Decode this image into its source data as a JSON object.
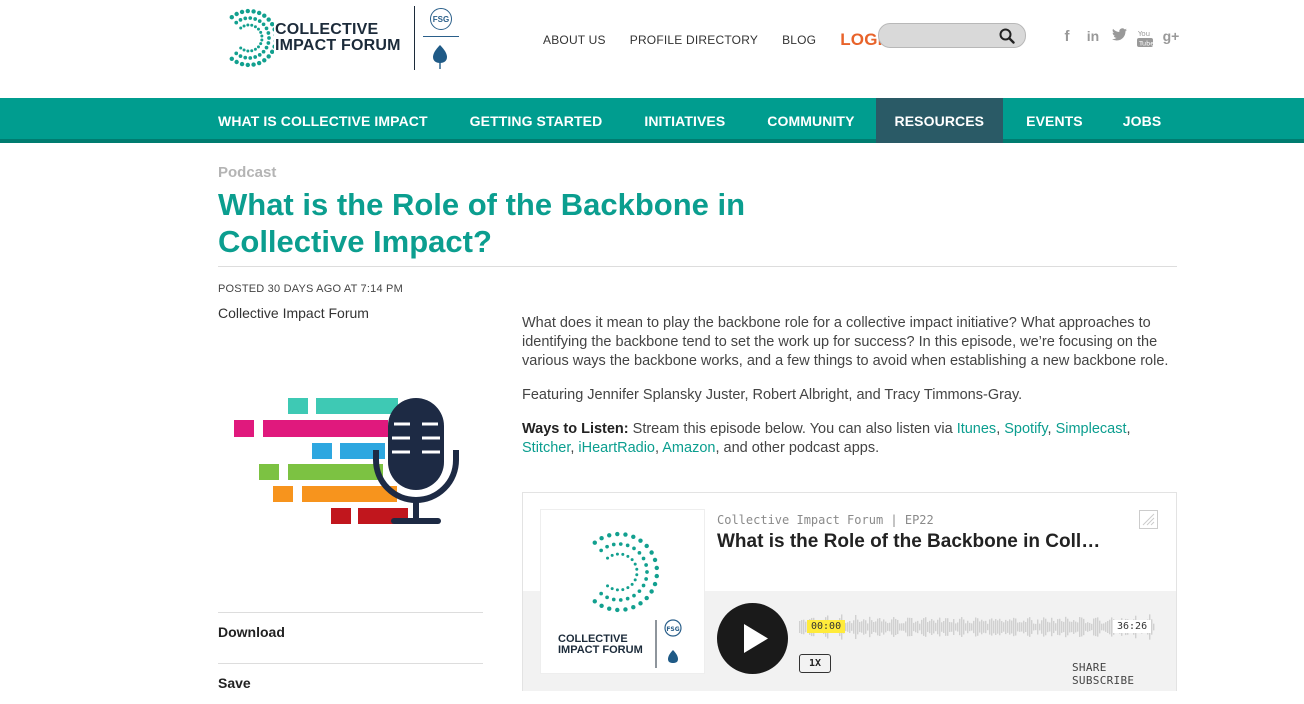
{
  "logo": {
    "line1": "COLLECTIVE",
    "line2": "IMPACT FORUM",
    "badge": "FSG"
  },
  "topnav": {
    "items": [
      "ABOUT US",
      "PROFILE DIRECTORY",
      "BLOG"
    ],
    "login": "LOGIN"
  },
  "search": {
    "placeholder": ""
  },
  "social": [
    "facebook-icon",
    "linkedin-icon",
    "twitter-icon",
    "youtube-icon",
    "google-plus-icon"
  ],
  "mainnav": {
    "items": [
      "WHAT IS COLLECTIVE IMPACT",
      "GETTING STARTED",
      "INITIATIVES",
      "COMMUNITY",
      "RESOURCES",
      "EVENTS",
      "JOBS"
    ],
    "active": "RESOURCES"
  },
  "article": {
    "eyebrow": "Podcast",
    "title": "What is the Role of the Backbone in Collective Impact?",
    "posted": "POSTED 30 DAYS AGO AT 7:14 PM",
    "author": "Collective Impact Forum",
    "p1": "What does it mean to play the backbone role for a collective impact initiative? What approaches to identifying the backbone tend to set the work up for success? In this episode, we’re focusing on the various ways the backbone works, and a few things to avoid when establishing a new backbone role.",
    "p2": "Featuring Jennifer Splansky Juster, Robert Albright, and Tracy Timmons-Gray.",
    "ways_label": "Ways to Listen:",
    "ways_text": " Stream this episode below. You can also listen via ",
    "links": [
      "Itunes",
      "Spotify",
      "Simplecast",
      "Stitcher",
      "iHeartRadio",
      "Amazon"
    ],
    "ways_tail": ", and other podcast apps."
  },
  "sidebar": {
    "download": "Download",
    "save": "Save"
  },
  "player": {
    "show": "Collective Impact Forum | EP22",
    "episode_title": "What is the Role of the Backbone in Collective Impact?",
    "current_time": "00:00",
    "duration": "36:26",
    "speed": "1X",
    "share": "SHARE",
    "subscribe": "SUBSCRIBE",
    "cover_line1": "COLLECTIVE",
    "cover_line2": "IMPACT FORUM",
    "cover_badge": "FSG"
  },
  "colors": {
    "brand_teal": "#009d8f",
    "active_nav": "#2a5a66",
    "login_orange": "#e8632a"
  }
}
